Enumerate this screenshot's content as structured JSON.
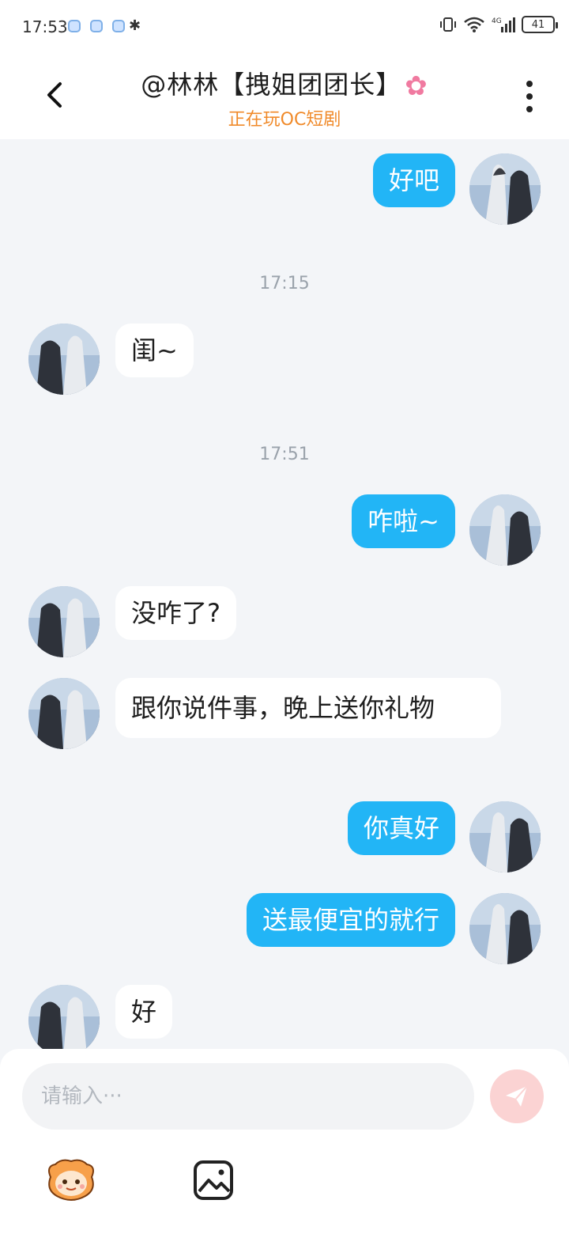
{
  "status_bar": {
    "time": "17:53",
    "battery": "41"
  },
  "header": {
    "title": "@林林【拽姐团团长】",
    "subtitle": "正在玩OC短剧",
    "icons": {
      "back": "chevron-left-icon",
      "more": "more-vertical-icon",
      "flower": "cherry-blossom-icon"
    }
  },
  "messages": [
    {
      "side": "out",
      "text": "好吧"
    },
    {
      "timestamp": "17:15"
    },
    {
      "side": "in",
      "text": "闺~"
    },
    {
      "timestamp": "17:51"
    },
    {
      "side": "out",
      "text": "咋啦~"
    },
    {
      "side": "in",
      "text": "没咋了?"
    },
    {
      "side": "in",
      "text": "跟你说件事，晚上送你礼物"
    },
    {
      "side": "out",
      "text": "你真好"
    },
    {
      "side": "out",
      "text": "送最便宜的就行"
    },
    {
      "side": "in",
      "text": "好"
    }
  ],
  "input": {
    "placeholder": "请输入···"
  },
  "toolbar": {
    "icons": {
      "send": "send-icon",
      "emoji": "mascot-emoji-icon",
      "image": "image-icon"
    }
  },
  "colors": {
    "outgoing_bubble": "#22b5f6",
    "incoming_bubble": "#ffffff",
    "subtitle": "#f08a2a",
    "background": "#f3f5f8"
  }
}
